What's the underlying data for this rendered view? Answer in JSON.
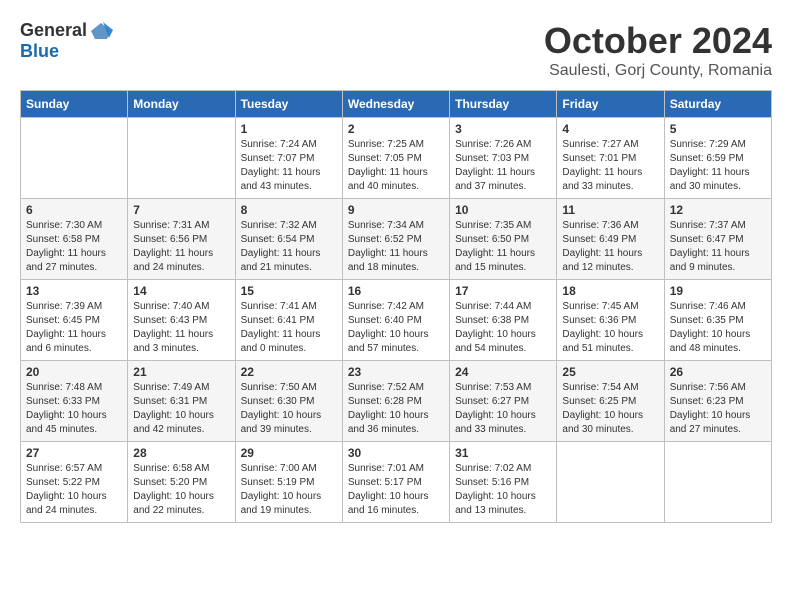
{
  "logo": {
    "general": "General",
    "blue": "Blue"
  },
  "title": "October 2024",
  "subtitle": "Saulesti, Gorj County, Romania",
  "weekdays": [
    "Sunday",
    "Monday",
    "Tuesday",
    "Wednesday",
    "Thursday",
    "Friday",
    "Saturday"
  ],
  "weeks": [
    [
      {
        "day": "",
        "sunrise": "",
        "sunset": "",
        "daylight": ""
      },
      {
        "day": "",
        "sunrise": "",
        "sunset": "",
        "daylight": ""
      },
      {
        "day": "1",
        "sunrise": "Sunrise: 7:24 AM",
        "sunset": "Sunset: 7:07 PM",
        "daylight": "Daylight: 11 hours and 43 minutes."
      },
      {
        "day": "2",
        "sunrise": "Sunrise: 7:25 AM",
        "sunset": "Sunset: 7:05 PM",
        "daylight": "Daylight: 11 hours and 40 minutes."
      },
      {
        "day": "3",
        "sunrise": "Sunrise: 7:26 AM",
        "sunset": "Sunset: 7:03 PM",
        "daylight": "Daylight: 11 hours and 37 minutes."
      },
      {
        "day": "4",
        "sunrise": "Sunrise: 7:27 AM",
        "sunset": "Sunset: 7:01 PM",
        "daylight": "Daylight: 11 hours and 33 minutes."
      },
      {
        "day": "5",
        "sunrise": "Sunrise: 7:29 AM",
        "sunset": "Sunset: 6:59 PM",
        "daylight": "Daylight: 11 hours and 30 minutes."
      }
    ],
    [
      {
        "day": "6",
        "sunrise": "Sunrise: 7:30 AM",
        "sunset": "Sunset: 6:58 PM",
        "daylight": "Daylight: 11 hours and 27 minutes."
      },
      {
        "day": "7",
        "sunrise": "Sunrise: 7:31 AM",
        "sunset": "Sunset: 6:56 PM",
        "daylight": "Daylight: 11 hours and 24 minutes."
      },
      {
        "day": "8",
        "sunrise": "Sunrise: 7:32 AM",
        "sunset": "Sunset: 6:54 PM",
        "daylight": "Daylight: 11 hours and 21 minutes."
      },
      {
        "day": "9",
        "sunrise": "Sunrise: 7:34 AM",
        "sunset": "Sunset: 6:52 PM",
        "daylight": "Daylight: 11 hours and 18 minutes."
      },
      {
        "day": "10",
        "sunrise": "Sunrise: 7:35 AM",
        "sunset": "Sunset: 6:50 PM",
        "daylight": "Daylight: 11 hours and 15 minutes."
      },
      {
        "day": "11",
        "sunrise": "Sunrise: 7:36 AM",
        "sunset": "Sunset: 6:49 PM",
        "daylight": "Daylight: 11 hours and 12 minutes."
      },
      {
        "day": "12",
        "sunrise": "Sunrise: 7:37 AM",
        "sunset": "Sunset: 6:47 PM",
        "daylight": "Daylight: 11 hours and 9 minutes."
      }
    ],
    [
      {
        "day": "13",
        "sunrise": "Sunrise: 7:39 AM",
        "sunset": "Sunset: 6:45 PM",
        "daylight": "Daylight: 11 hours and 6 minutes."
      },
      {
        "day": "14",
        "sunrise": "Sunrise: 7:40 AM",
        "sunset": "Sunset: 6:43 PM",
        "daylight": "Daylight: 11 hours and 3 minutes."
      },
      {
        "day": "15",
        "sunrise": "Sunrise: 7:41 AM",
        "sunset": "Sunset: 6:41 PM",
        "daylight": "Daylight: 11 hours and 0 minutes."
      },
      {
        "day": "16",
        "sunrise": "Sunrise: 7:42 AM",
        "sunset": "Sunset: 6:40 PM",
        "daylight": "Daylight: 10 hours and 57 minutes."
      },
      {
        "day": "17",
        "sunrise": "Sunrise: 7:44 AM",
        "sunset": "Sunset: 6:38 PM",
        "daylight": "Daylight: 10 hours and 54 minutes."
      },
      {
        "day": "18",
        "sunrise": "Sunrise: 7:45 AM",
        "sunset": "Sunset: 6:36 PM",
        "daylight": "Daylight: 10 hours and 51 minutes."
      },
      {
        "day": "19",
        "sunrise": "Sunrise: 7:46 AM",
        "sunset": "Sunset: 6:35 PM",
        "daylight": "Daylight: 10 hours and 48 minutes."
      }
    ],
    [
      {
        "day": "20",
        "sunrise": "Sunrise: 7:48 AM",
        "sunset": "Sunset: 6:33 PM",
        "daylight": "Daylight: 10 hours and 45 minutes."
      },
      {
        "day": "21",
        "sunrise": "Sunrise: 7:49 AM",
        "sunset": "Sunset: 6:31 PM",
        "daylight": "Daylight: 10 hours and 42 minutes."
      },
      {
        "day": "22",
        "sunrise": "Sunrise: 7:50 AM",
        "sunset": "Sunset: 6:30 PM",
        "daylight": "Daylight: 10 hours and 39 minutes."
      },
      {
        "day": "23",
        "sunrise": "Sunrise: 7:52 AM",
        "sunset": "Sunset: 6:28 PM",
        "daylight": "Daylight: 10 hours and 36 minutes."
      },
      {
        "day": "24",
        "sunrise": "Sunrise: 7:53 AM",
        "sunset": "Sunset: 6:27 PM",
        "daylight": "Daylight: 10 hours and 33 minutes."
      },
      {
        "day": "25",
        "sunrise": "Sunrise: 7:54 AM",
        "sunset": "Sunset: 6:25 PM",
        "daylight": "Daylight: 10 hours and 30 minutes."
      },
      {
        "day": "26",
        "sunrise": "Sunrise: 7:56 AM",
        "sunset": "Sunset: 6:23 PM",
        "daylight": "Daylight: 10 hours and 27 minutes."
      }
    ],
    [
      {
        "day": "27",
        "sunrise": "Sunrise: 6:57 AM",
        "sunset": "Sunset: 5:22 PM",
        "daylight": "Daylight: 10 hours and 24 minutes."
      },
      {
        "day": "28",
        "sunrise": "Sunrise: 6:58 AM",
        "sunset": "Sunset: 5:20 PM",
        "daylight": "Daylight: 10 hours and 22 minutes."
      },
      {
        "day": "29",
        "sunrise": "Sunrise: 7:00 AM",
        "sunset": "Sunset: 5:19 PM",
        "daylight": "Daylight: 10 hours and 19 minutes."
      },
      {
        "day": "30",
        "sunrise": "Sunrise: 7:01 AM",
        "sunset": "Sunset: 5:17 PM",
        "daylight": "Daylight: 10 hours and 16 minutes."
      },
      {
        "day": "31",
        "sunrise": "Sunrise: 7:02 AM",
        "sunset": "Sunset: 5:16 PM",
        "daylight": "Daylight: 10 hours and 13 minutes."
      },
      {
        "day": "",
        "sunrise": "",
        "sunset": "",
        "daylight": ""
      },
      {
        "day": "",
        "sunrise": "",
        "sunset": "",
        "daylight": ""
      }
    ]
  ]
}
